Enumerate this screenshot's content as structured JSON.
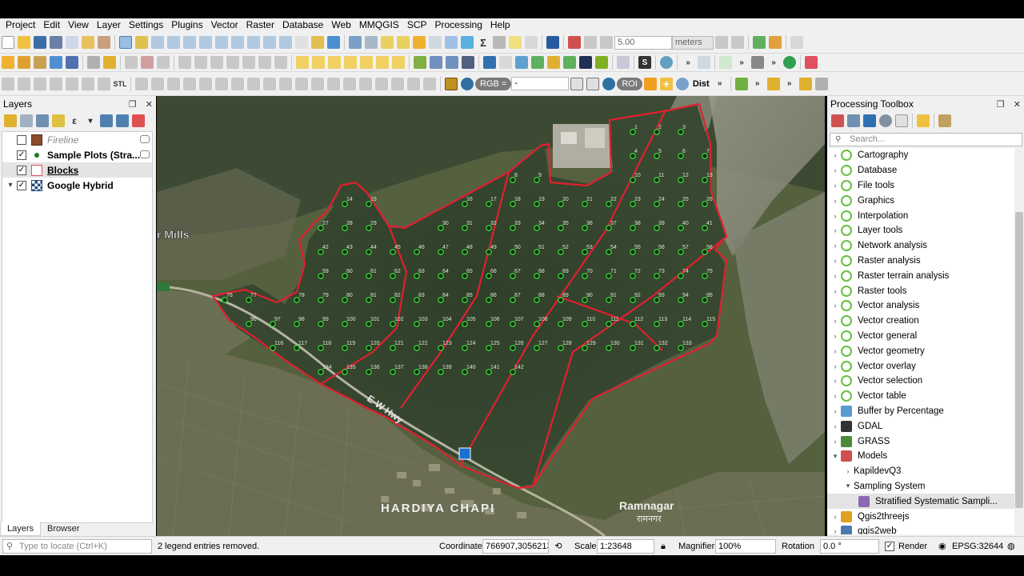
{
  "menubar": {
    "items": [
      "Project",
      "Edit",
      "View",
      "Layer",
      "Settings",
      "Plugins",
      "Vector",
      "Raster",
      "Database",
      "Web",
      "MMQGIS",
      "SCP",
      "Processing",
      "Help"
    ]
  },
  "toolbar": {
    "snap_value": "5.00",
    "snap_units": "meters",
    "stl_label": "STL",
    "rgb_label": "RGB =",
    "rgb_value": "-",
    "roi_label": "ROI",
    "dist_label": "Dist",
    "s_label": "S"
  },
  "layers_panel": {
    "title": "Layers",
    "layers": [
      {
        "name": "Fireline",
        "checked": false,
        "symbol_color": "#8b4a2b",
        "italic": true
      },
      {
        "name": "Sample Plots (Stra...",
        "checked": true,
        "symbol_color": "#1a7a1a"
      },
      {
        "name": "Blocks",
        "checked": true,
        "symbol_color": "#e05060",
        "selected": true
      },
      {
        "name": "Google Hybrid",
        "checked": true,
        "expanded": true
      }
    ],
    "tabs": [
      "Layers",
      "Browser"
    ]
  },
  "map": {
    "labels": [
      "r Mills",
      "HARDIYA CHAPI",
      "Ramnagar",
      "रामनगर",
      "E-W Hwy"
    ],
    "accent": "#e02030",
    "plot_color": "#3ad03a",
    "plot_numbers": [
      "1",
      "2",
      "3",
      "4",
      "5",
      "6",
      "7",
      "8",
      "9",
      "10",
      "11",
      "12",
      "13",
      "14",
      "15",
      "16",
      "17",
      "18",
      "19",
      "20",
      "21",
      "22",
      "23",
      "24",
      "25",
      "26",
      "27",
      "28",
      "29",
      "30",
      "31",
      "32",
      "33",
      "34",
      "35",
      "36",
      "37",
      "38",
      "39",
      "40",
      "41",
      "42",
      "43",
      "44",
      "45",
      "46",
      "47",
      "48",
      "49",
      "50",
      "51",
      "52",
      "53",
      "54",
      "55",
      "56",
      "57",
      "58",
      "59",
      "60",
      "61",
      "62",
      "63",
      "64",
      "65",
      "66",
      "67",
      "68",
      "69",
      "70",
      "71",
      "72",
      "73",
      "74",
      "75",
      "76",
      "77",
      "78",
      "79",
      "80",
      "81",
      "82",
      "83",
      "84",
      "85",
      "86",
      "87",
      "88",
      "89",
      "90",
      "91",
      "92",
      "93",
      "94",
      "95",
      "96",
      "97",
      "98",
      "99",
      "100",
      "101",
      "102",
      "103",
      "104",
      "105",
      "106",
      "107",
      "108",
      "109",
      "110",
      "111",
      "112",
      "113",
      "114",
      "115",
      "116",
      "117",
      "118",
      "119",
      "120",
      "121",
      "122",
      "123",
      "124",
      "125",
      "126",
      "127",
      "128",
      "129",
      "130",
      "131",
      "132",
      "133",
      "134",
      "135",
      "136",
      "137",
      "138",
      "139",
      "140",
      "141",
      "142"
    ]
  },
  "toolbox": {
    "title": "Processing Toolbox",
    "search_placeholder": "Search...",
    "groups": [
      {
        "label": "Cartography",
        "icon": "q-icon"
      },
      {
        "label": "Database",
        "icon": "q-icon"
      },
      {
        "label": "File tools",
        "icon": "q-icon"
      },
      {
        "label": "Graphics",
        "icon": "q-icon"
      },
      {
        "label": "Interpolation",
        "icon": "q-icon"
      },
      {
        "label": "Layer tools",
        "icon": "q-icon"
      },
      {
        "label": "Network analysis",
        "icon": "q-icon"
      },
      {
        "label": "Raster analysis",
        "icon": "q-icon"
      },
      {
        "label": "Raster terrain analysis",
        "icon": "q-icon"
      },
      {
        "label": "Raster tools",
        "icon": "q-icon"
      },
      {
        "label": "Vector analysis",
        "icon": "q-icon"
      },
      {
        "label": "Vector creation",
        "icon": "q-icon"
      },
      {
        "label": "Vector general",
        "icon": "q-icon"
      },
      {
        "label": "Vector geometry",
        "icon": "q-icon"
      },
      {
        "label": "Vector overlay",
        "icon": "q-icon"
      },
      {
        "label": "Vector selection",
        "icon": "q-icon"
      },
      {
        "label": "Vector table",
        "icon": "q-icon"
      },
      {
        "label": "Buffer by Percentage",
        "icon": "buffer-icon"
      },
      {
        "label": "GDAL",
        "icon": "gdal-icon"
      },
      {
        "label": "GRASS",
        "icon": "grass-icon"
      },
      {
        "label": "Models",
        "icon": "models-icon",
        "expanded": true
      },
      {
        "label": "KapildevQ3",
        "indent": 1
      },
      {
        "label": "Sampling System",
        "indent": 1,
        "expanded": true
      },
      {
        "label": "Stratified Systematic Sampli...",
        "indent": 2,
        "selected": true,
        "icon": "model-icon"
      },
      {
        "label": "Qgis2threejs",
        "icon": "threejs-icon"
      },
      {
        "label": "qgis2web",
        "icon": "qgis2web-icon"
      }
    ]
  },
  "statusbar": {
    "locator_placeholder": "Type to locate (Ctrl+K)",
    "message": "2 legend entries removed.",
    "coordinate_label": "Coordinate",
    "coordinate_value": "766907,3056213",
    "scale_label": "Scale",
    "scale_value": "1:23648",
    "magnifier_label": "Magnifier",
    "magnifier_value": "100%",
    "rotation_label": "Rotation",
    "rotation_value": "0.0 °",
    "render_label": "Render",
    "crs_label": "EPSG:32644"
  }
}
